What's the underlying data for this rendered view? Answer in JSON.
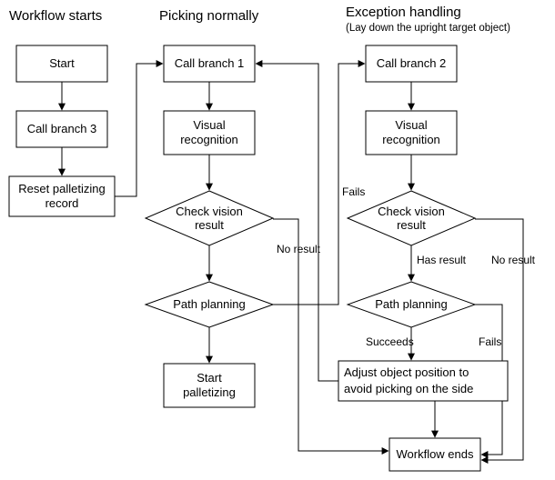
{
  "headings": {
    "col1": "Workflow starts",
    "col2": "Picking normally",
    "col3": "Exception handling",
    "col3_sub": "(Lay down the upright target object)"
  },
  "nodes": {
    "start": "Start",
    "call_branch_3": "Call branch 3",
    "reset_palletizing_r1": "Reset palletizing",
    "reset_palletizing_r2": "record",
    "call_branch_1": "Call branch 1",
    "visual_recog_1a": "Visual",
    "visual_recog_1b": "recognition",
    "check_vision_1a": "Check vision",
    "check_vision_1b": "result",
    "path_planning_1": "Path planning",
    "start_palletizing_a": "Start",
    "start_palletizing_b": "palletizing",
    "call_branch_2": "Call branch 2",
    "visual_recog_2a": "Visual",
    "visual_recog_2b": "recognition",
    "check_vision_2a": "Check vision",
    "check_vision_2b": "result",
    "path_planning_2": "Path planning",
    "adjust_a": "Adjust object position to",
    "adjust_b": "avoid picking on the side",
    "workflow_ends": "Workflow ends"
  },
  "edges": {
    "no_result_col2": "No result",
    "fails_col2": "Fails",
    "no_result_col3": "No result",
    "has_result_col3": "Has result",
    "succeeds_col3": "Succeeds",
    "fails_col3": "Fails"
  }
}
